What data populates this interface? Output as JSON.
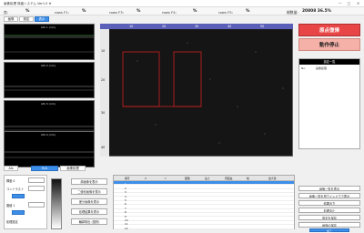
{
  "title_bar": {
    "text": "画像処理 検査システム Ver1.0 ※",
    "min": "—",
    "max": "□",
    "close": "✕"
  },
  "status": {
    "items": [
      {
        "label": "良:",
        "value": "%"
      },
      {
        "label": "rows  F1:",
        "value": "%"
      },
      {
        "label": "rows  F3:",
        "value": "%"
      },
      {
        "label": "rows  F4:",
        "value": "%"
      },
      {
        "label": "rows  F5:",
        "value": "%"
      }
    ],
    "count_label": "総数量:",
    "count_value": "20808 36.5%"
  },
  "top_tabs": [
    "画像",
    "設定",
    "表示"
  ],
  "charts": [
    {
      "title": "AIS 1 (nm)"
    },
    {
      "title": "AIS 2 (nm)"
    },
    {
      "title": "AIS 3 (nm)"
    },
    {
      "title": "AIS 4 (nm)"
    }
  ],
  "heatmap": {
    "top_ticks": [
      "10",
      "20",
      "30",
      "40",
      "50"
    ],
    "left_ticks": [
      "10",
      "20",
      "30",
      "40"
    ]
  },
  "right_panel": {
    "btn_origin": "原点復帰",
    "btn_stop": "動作停止",
    "table_header": "設定一覧",
    "table_rows": [
      {
        "k": "No.",
        "v": "画像処理"
      }
    ]
  },
  "bottom_tabs": [
    "Ais",
    "R/A",
    "画像処理"
  ],
  "left_controls": {
    "rows": [
      {
        "label": "輝度 0",
        "btn": ""
      },
      {
        "label": "コントラスト",
        "btn": ""
      },
      {
        "label": "",
        "btn": ""
      },
      {
        "label": "閾値 1",
        "btn": ""
      },
      {
        "label": "",
        "btn": ""
      },
      {
        "label": "処理設定",
        "btn": ""
      }
    ]
  },
  "middle_buttons": [
    "原画像を表示",
    "二値化画像を表示",
    "差分画像を表示",
    "処理結果を表示",
    "輪郭検出 (選択)"
  ],
  "grid": {
    "headers": [
      "",
      "番号",
      "X",
      "Y",
      "面積",
      "長さ",
      "周囲長",
      "幅",
      "最大値"
    ],
    "rows": [
      [
        "",
        "1",
        "—",
        "",
        "",
        "",
        "",
        "",
        ""
      ],
      [
        "",
        "2",
        "",
        "",
        "",
        "",
        "",
        "",
        ""
      ],
      [
        "",
        "3",
        "",
        "",
        "",
        "",
        "",
        "",
        ""
      ],
      [
        "",
        "4",
        "",
        "",
        "",
        "",
        "",
        "",
        ""
      ],
      [
        "",
        "5",
        "",
        "",
        "",
        "",
        "",
        "",
        ""
      ],
      [
        "",
        "6",
        "",
        "",
        "",
        "",
        "",
        "",
        ""
      ],
      [
        "",
        "7",
        "",
        "",
        "",
        "",
        "",
        "",
        ""
      ],
      [
        "",
        "8",
        "",
        "",
        "",
        "",
        "",
        "",
        ""
      ],
      [
        "",
        "9",
        "",
        "",
        "",
        "",
        "",
        "",
        ""
      ],
      [
        "",
        "10",
        "",
        "",
        "",
        "",
        "",
        "",
        ""
      ],
      [
        "",
        "11",
        "",
        "",
        "",
        "",
        "",
        "",
        ""
      ],
      [
        "",
        "12",
        "",
        "",
        "",
        "",
        "",
        "",
        ""
      ]
    ]
  },
  "right_buttons": [
    "画像一覧を表示",
    "画像一覧を別ウインドウで表示",
    "結果出力",
    "処理中止",
    "設定を保存",
    "画像の保存"
  ],
  "footer_button": "終了"
}
